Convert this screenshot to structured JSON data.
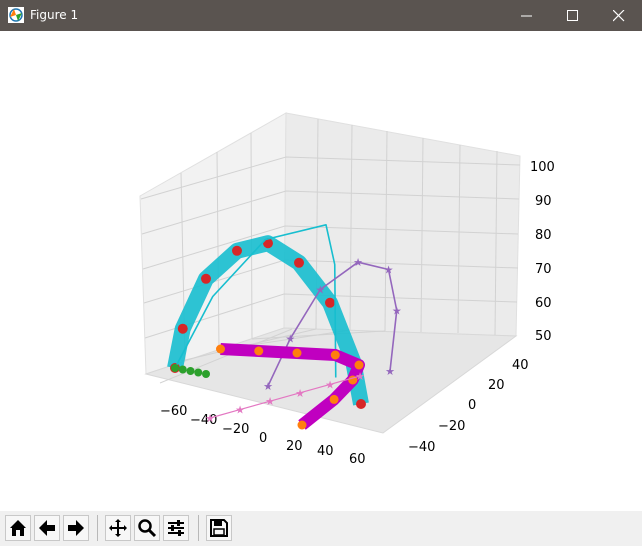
{
  "window": {
    "title": "Figure 1",
    "controls": [
      "minimize",
      "maximize",
      "close"
    ]
  },
  "toolbar": {
    "buttons": [
      {
        "name": "home",
        "icon": "home-icon"
      },
      {
        "name": "back",
        "icon": "arrow-left-icon"
      },
      {
        "name": "forward",
        "icon": "arrow-right-icon"
      },
      {
        "name": "pan",
        "icon": "move-icon"
      },
      {
        "name": "zoom",
        "icon": "magnifier-icon"
      },
      {
        "name": "configure-subplots",
        "icon": "sliders-icon"
      },
      {
        "name": "save",
        "icon": "floppy-disk-icon"
      }
    ]
  },
  "chart_data": {
    "type": "line3d",
    "title": "",
    "xlabel": "",
    "ylabel": "",
    "zlabel": "",
    "x_ticks": [
      "−60",
      "−40",
      "−20",
      "0",
      "20",
      "40",
      "60"
    ],
    "y_ticks": [
      "−40",
      "−20",
      "0",
      "20",
      "40"
    ],
    "z_ticks": [
      "50",
      "60",
      "70",
      "80",
      "90",
      "100"
    ],
    "xlim": [
      -70,
      70
    ],
    "ylim": [
      -50,
      50
    ],
    "zlim": [
      50,
      100
    ],
    "grid": true,
    "series": [
      {
        "style": "thick cyan line with red circle markers",
        "color": "#17becf",
        "x": [
          -60,
          -55,
          -40,
          -20,
          0,
          20,
          40,
          55,
          60
        ],
        "y": [
          0,
          0,
          0,
          0,
          0,
          0,
          0,
          0,
          0
        ],
        "z": [
          50,
          62,
          78,
          88,
          92,
          88,
          78,
          62,
          50
        ]
      },
      {
        "style": "thin cyan line",
        "color": "#17becf",
        "x": [
          -60,
          -45,
          -25,
          0,
          15,
          25
        ],
        "y": [
          0,
          10,
          25,
          40,
          30,
          20
        ],
        "z": [
          50,
          70,
          85,
          88,
          80,
          50
        ]
      },
      {
        "style": "purple line with star markers",
        "color": "#9467bd",
        "x": [
          0,
          5,
          15,
          30,
          45,
          55,
          60
        ],
        "y": [
          0,
          10,
          20,
          30,
          35,
          30,
          20
        ],
        "z": [
          50,
          62,
          75,
          82,
          80,
          70,
          55
        ]
      },
      {
        "style": "thick magenta line with orange/olive circle markers",
        "color": "#c000c0",
        "x": [
          -40,
          -20,
          0,
          20,
          40,
          50,
          52,
          50
        ],
        "y": [
          10,
          15,
          20,
          25,
          20,
          5,
          -10,
          -30
        ],
        "z": [
          55,
          55,
          55,
          55,
          55,
          55,
          53,
          50
        ]
      },
      {
        "style": "pink line with star markers",
        "color": "#e377c2",
        "x": [
          0,
          10,
          20,
          30,
          40,
          50
        ],
        "y": [
          -40,
          -30,
          -20,
          -10,
          0,
          10
        ],
        "z": [
          50,
          51,
          52,
          53,
          54,
          55
        ]
      },
      {
        "style": "green markers",
        "color": "#2ca02c",
        "x": [
          -60,
          -55,
          -50,
          -45,
          -40
        ],
        "y": [
          0,
          0,
          0,
          0,
          0
        ],
        "z": [
          50,
          50,
          50,
          50,
          50
        ]
      }
    ]
  }
}
